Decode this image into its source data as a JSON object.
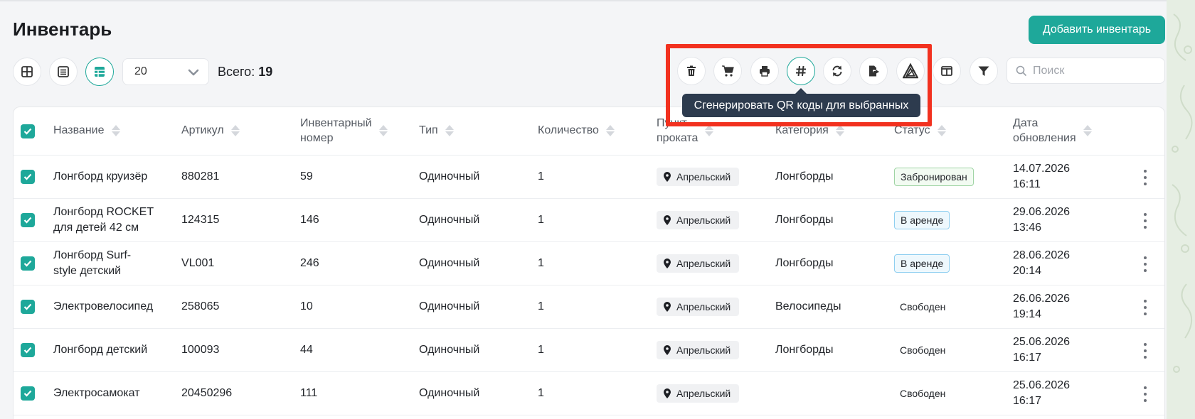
{
  "page": {
    "title": "Инвентарь",
    "add_button": "Добавить инвентарь"
  },
  "toolbar": {
    "view_icons": [
      "grid-view-icon",
      "list-view-icon",
      "table-view-icon"
    ],
    "active_view": "table-view-icon",
    "per_page_value": "20",
    "total_label": "Всего:",
    "total_count": "19",
    "actions": [
      "trash-icon",
      "cart-icon",
      "print-icon",
      "hash-icon",
      "refresh-icon",
      "export-icon",
      "logo-icon",
      "columns-icon",
      "filter-icon"
    ],
    "search_placeholder": "Поиск",
    "tooltip": "Сгенерировать QR коды для выбранных"
  },
  "table": {
    "headers": {
      "name": "Название",
      "article": "Артикул",
      "inv_number": [
        "Инвентарный",
        "номер"
      ],
      "type": "Тип",
      "quantity": "Количество",
      "point": [
        "Пункт",
        "проката"
      ],
      "category": "Категория",
      "status": "Статус",
      "updated": [
        "Дата",
        "обновления"
      ]
    },
    "rows": [
      {
        "name": [
          "Лонгборд круизёр"
        ],
        "article": "880281",
        "inv": "59",
        "type": "Одиночный",
        "qty": "1",
        "point": "Апрельский",
        "category": "Лонгборды",
        "status": "Забронирован",
        "status_kind": "booked",
        "date": "14.07.2026",
        "time": "16:11"
      },
      {
        "name": [
          "Лонгборд ROCKET",
          "для детей 42 см"
        ],
        "article": "124315",
        "inv": "146",
        "type": "Одиночный",
        "qty": "1",
        "point": "Апрельский",
        "category": "Лонгборды",
        "status": "В аренде",
        "status_kind": "rented",
        "date": "29.06.2026",
        "time": "13:46"
      },
      {
        "name": [
          "Лонгборд Surf-",
          "style детский"
        ],
        "article": "VL001",
        "inv": "246",
        "type": "Одиночный",
        "qty": "1",
        "point": "Апрельский",
        "category": "Лонгборды",
        "status": "В аренде",
        "status_kind": "rented",
        "date": "28.06.2026",
        "time": "20:14"
      },
      {
        "name": [
          "Электровелосипед"
        ],
        "article": "258065",
        "inv": "10",
        "type": "Одиночный",
        "qty": "1",
        "point": "Апрельский",
        "category": "Велосипеды",
        "status": "Свободен",
        "status_kind": "free",
        "date": "26.06.2026",
        "time": "19:14"
      },
      {
        "name": [
          "Лонгборд детский"
        ],
        "article": "100093",
        "inv": "44",
        "type": "Одиночный",
        "qty": "1",
        "point": "Апрельский",
        "category": "Лонгборды",
        "status": "Свободен",
        "status_kind": "free",
        "date": "25.06.2026",
        "time": "16:17"
      },
      {
        "name": [
          "Электросамокат"
        ],
        "article": "20450296",
        "inv": "111",
        "type": "Одиночный",
        "qty": "1",
        "point": "Апрельский",
        "category": "",
        "status": "Свободен",
        "status_kind": "free",
        "date": "25.06.2026",
        "time": "16:17"
      }
    ]
  },
  "colors": {
    "accent": "#1ea89a",
    "highlight": "#f2311f",
    "tooltip_bg": "#2d3b4e"
  }
}
